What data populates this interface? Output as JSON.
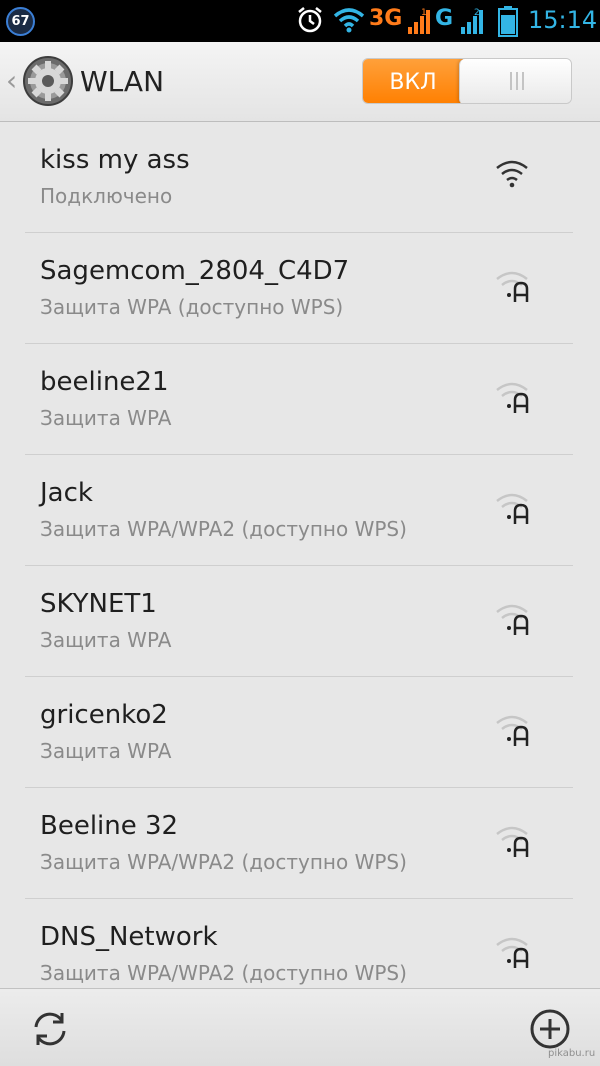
{
  "status_bar": {
    "notification_count": "67",
    "network_3g": "3G",
    "network_g": "G",
    "time": "15:14",
    "icons": [
      "alarm-icon",
      "wifi-icon",
      "signal-icon",
      "battery-icon"
    ]
  },
  "action_bar": {
    "title": "WLAN",
    "toggle_label": "ВКЛ",
    "back_icon": "‹",
    "accent_color": "#ff8a1a"
  },
  "networks": [
    {
      "name": "kiss my ass",
      "status": "Подключено",
      "secured": false
    },
    {
      "name": "Sagemcom_2804_C4D7",
      "status": "Защита WPA (доступно WPS)",
      "secured": true
    },
    {
      "name": "beeline21",
      "status": "Защита WPA",
      "secured": true
    },
    {
      "name": "Jack",
      "status": "Защита WPA/WPA2 (доступно WPS)",
      "secured": true
    },
    {
      "name": "SKYNET1",
      "status": "Защита WPA",
      "secured": true
    },
    {
      "name": "gricenko2",
      "status": "Защита WPA",
      "secured": true
    },
    {
      "name": "Beeline 32",
      "status": "Защита WPA/WPA2 (доступно WPS)",
      "secured": true
    },
    {
      "name": "DNS_Network",
      "status": "Защита WPA/WPA2 (доступно WPS)",
      "secured": true
    }
  ],
  "bottom_bar": {
    "refresh_icon": "refresh-icon",
    "add_icon": "add-icon"
  },
  "watermark": "pikabu.ru"
}
